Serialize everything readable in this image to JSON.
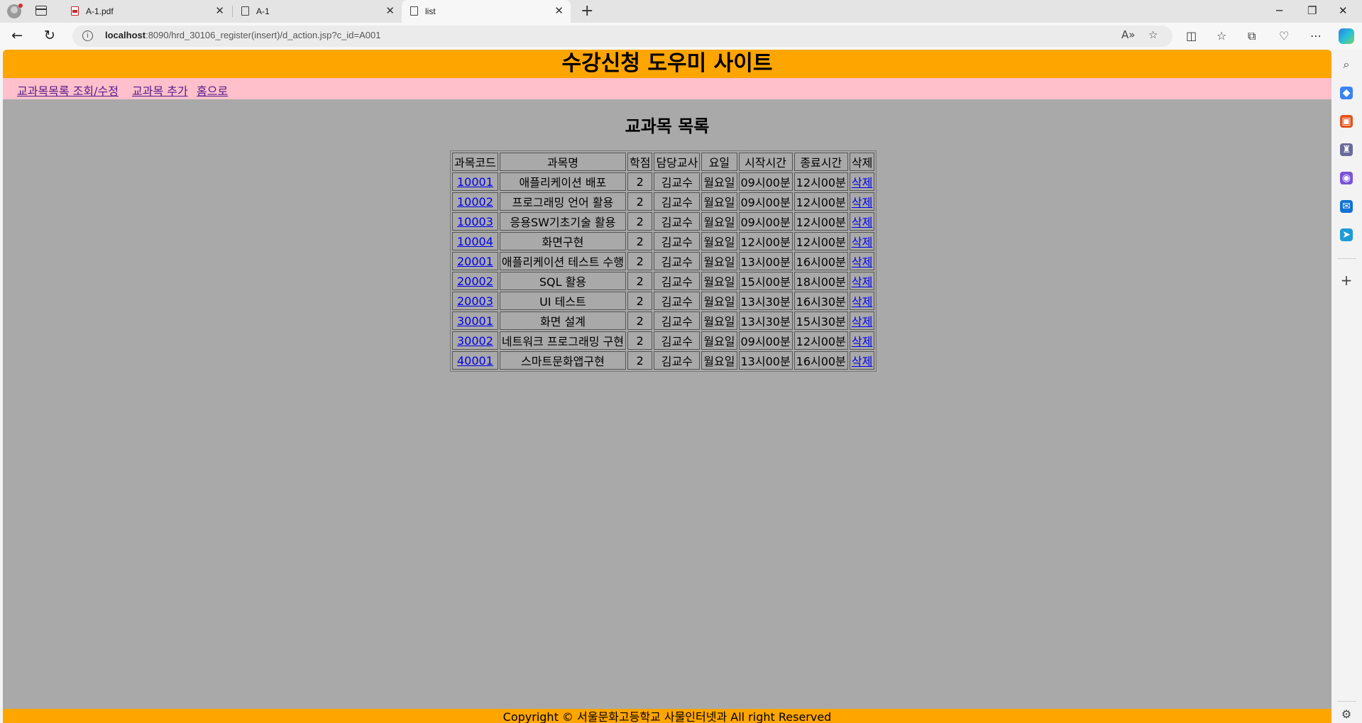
{
  "browser": {
    "tabs": [
      {
        "label": "A-1.pdf",
        "icon": "pdf-icon"
      },
      {
        "label": "A-1",
        "icon": "page-icon"
      },
      {
        "label": "list",
        "icon": "page-icon"
      }
    ],
    "url_host": "localhost",
    "url_rest": ":8090/hrd_30106_register(insert)/d_action.jsp?c_id=A001"
  },
  "site": {
    "header": "수강신청 도우미 사이트",
    "nav": [
      "교과목목록 조회/수정",
      "교과목 추가",
      "홈으로"
    ],
    "title": "교과목 목록",
    "columns": [
      "과목코드",
      "과목명",
      "학점",
      "담당교사",
      "요일",
      "시작시간",
      "종료시간",
      "삭제"
    ],
    "rows": [
      [
        "10001",
        "애플리케이션 배포",
        "2",
        "김교수",
        "월요일",
        "09시00분",
        "12시00분",
        "삭제"
      ],
      [
        "10002",
        "프로그래밍 언어 활용",
        "2",
        "김교수",
        "월요일",
        "09시00분",
        "12시00분",
        "삭제"
      ],
      [
        "10003",
        "응용SW기초기술 활용",
        "2",
        "김교수",
        "월요일",
        "09시00분",
        "12시00분",
        "삭제"
      ],
      [
        "10004",
        "화면구현",
        "2",
        "김교수",
        "월요일",
        "12시00분",
        "12시00분",
        "삭제"
      ],
      [
        "20001",
        "애플리케이션 테스트 수행",
        "2",
        "김교수",
        "월요일",
        "13시00분",
        "16시00분",
        "삭제"
      ],
      [
        "20002",
        "SQL 활용",
        "2",
        "김교수",
        "월요일",
        "15시00분",
        "18시00분",
        "삭제"
      ],
      [
        "20003",
        "UI 테스트",
        "2",
        "김교수",
        "월요일",
        "13시30분",
        "16시30분",
        "삭제"
      ],
      [
        "30001",
        "화면 설계",
        "2",
        "김교수",
        "월요일",
        "13시30분",
        "15시30분",
        "삭제"
      ],
      [
        "30002",
        "네트워크 프로그래밍 구현",
        "2",
        "김교수",
        "월요일",
        "09시00분",
        "12시00분",
        "삭제"
      ],
      [
        "40001",
        "스마트문화앱구현",
        "2",
        "김교수",
        "월요일",
        "13시00분",
        "16시00분",
        "삭제"
      ]
    ],
    "footer": "Copyright © 서울문화고등학교 사물인터넷과 All right Reserved"
  },
  "colors": {
    "header_bg": "#ffa500",
    "nav_bg": "#ffc0cb",
    "page_bg": "#a9a9a9",
    "link": "#0000ee",
    "visited_link": "#551a8b"
  }
}
